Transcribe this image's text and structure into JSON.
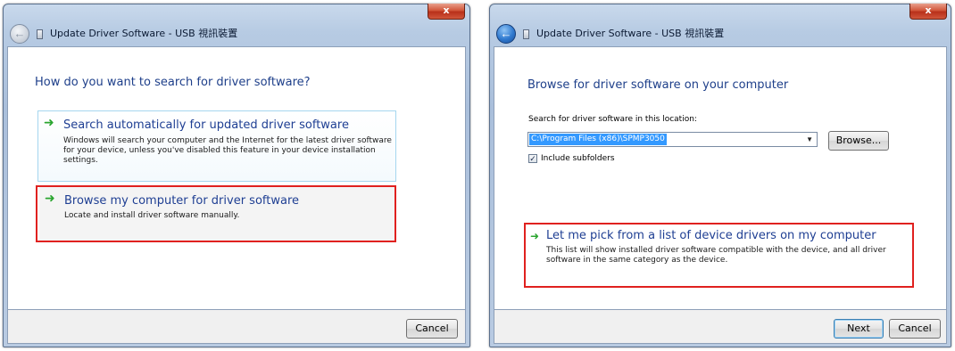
{
  "colors": {
    "heading": "#1e3f8a",
    "option_title": "#1f3f93",
    "arrow": "#2aa52f",
    "highlight": "#e0211f",
    "selection": "#3399ff"
  },
  "dialogs": [
    {
      "close_label": "x",
      "back_icon": "back-arrow-icon",
      "title": "Update Driver Software - USB 視訊裝置",
      "heading": "How do you want to search for driver software?",
      "options": [
        {
          "icon": "green-arrow-icon",
          "title": "Search automatically for updated driver software",
          "description_lines": [
            "Windows will search your computer and the Internet for the latest driver software",
            "for your device, unless you've disabled this feature in your device installation",
            "settings."
          ]
        },
        {
          "icon": "green-arrow-icon",
          "title": "Browse my computer for driver software",
          "description_lines": [
            "Locate and install driver software manually."
          ]
        }
      ],
      "buttons": {
        "cancel": "Cancel"
      }
    },
    {
      "close_label": "x",
      "back_icon": "back-arrow-icon",
      "title": "Update Driver Software - USB 視訊裝置",
      "heading": "Browse for driver software on your computer",
      "location_label": "Search for driver software in this location:",
      "location_value": "C:\\Program Files (x86)\\SPMP3050",
      "browse_label": "Browse...",
      "include_subfolders_label": "Include subfolders",
      "include_subfolders_checked": true,
      "options": [
        {
          "icon": "green-arrow-icon",
          "title": "Let me pick from a list of device drivers on my computer",
          "description_lines": [
            "This list will show installed driver software compatible with the device, and all driver",
            "software in the same category as the device."
          ]
        }
      ],
      "buttons": {
        "next": "Next",
        "cancel": "Cancel"
      }
    }
  ]
}
